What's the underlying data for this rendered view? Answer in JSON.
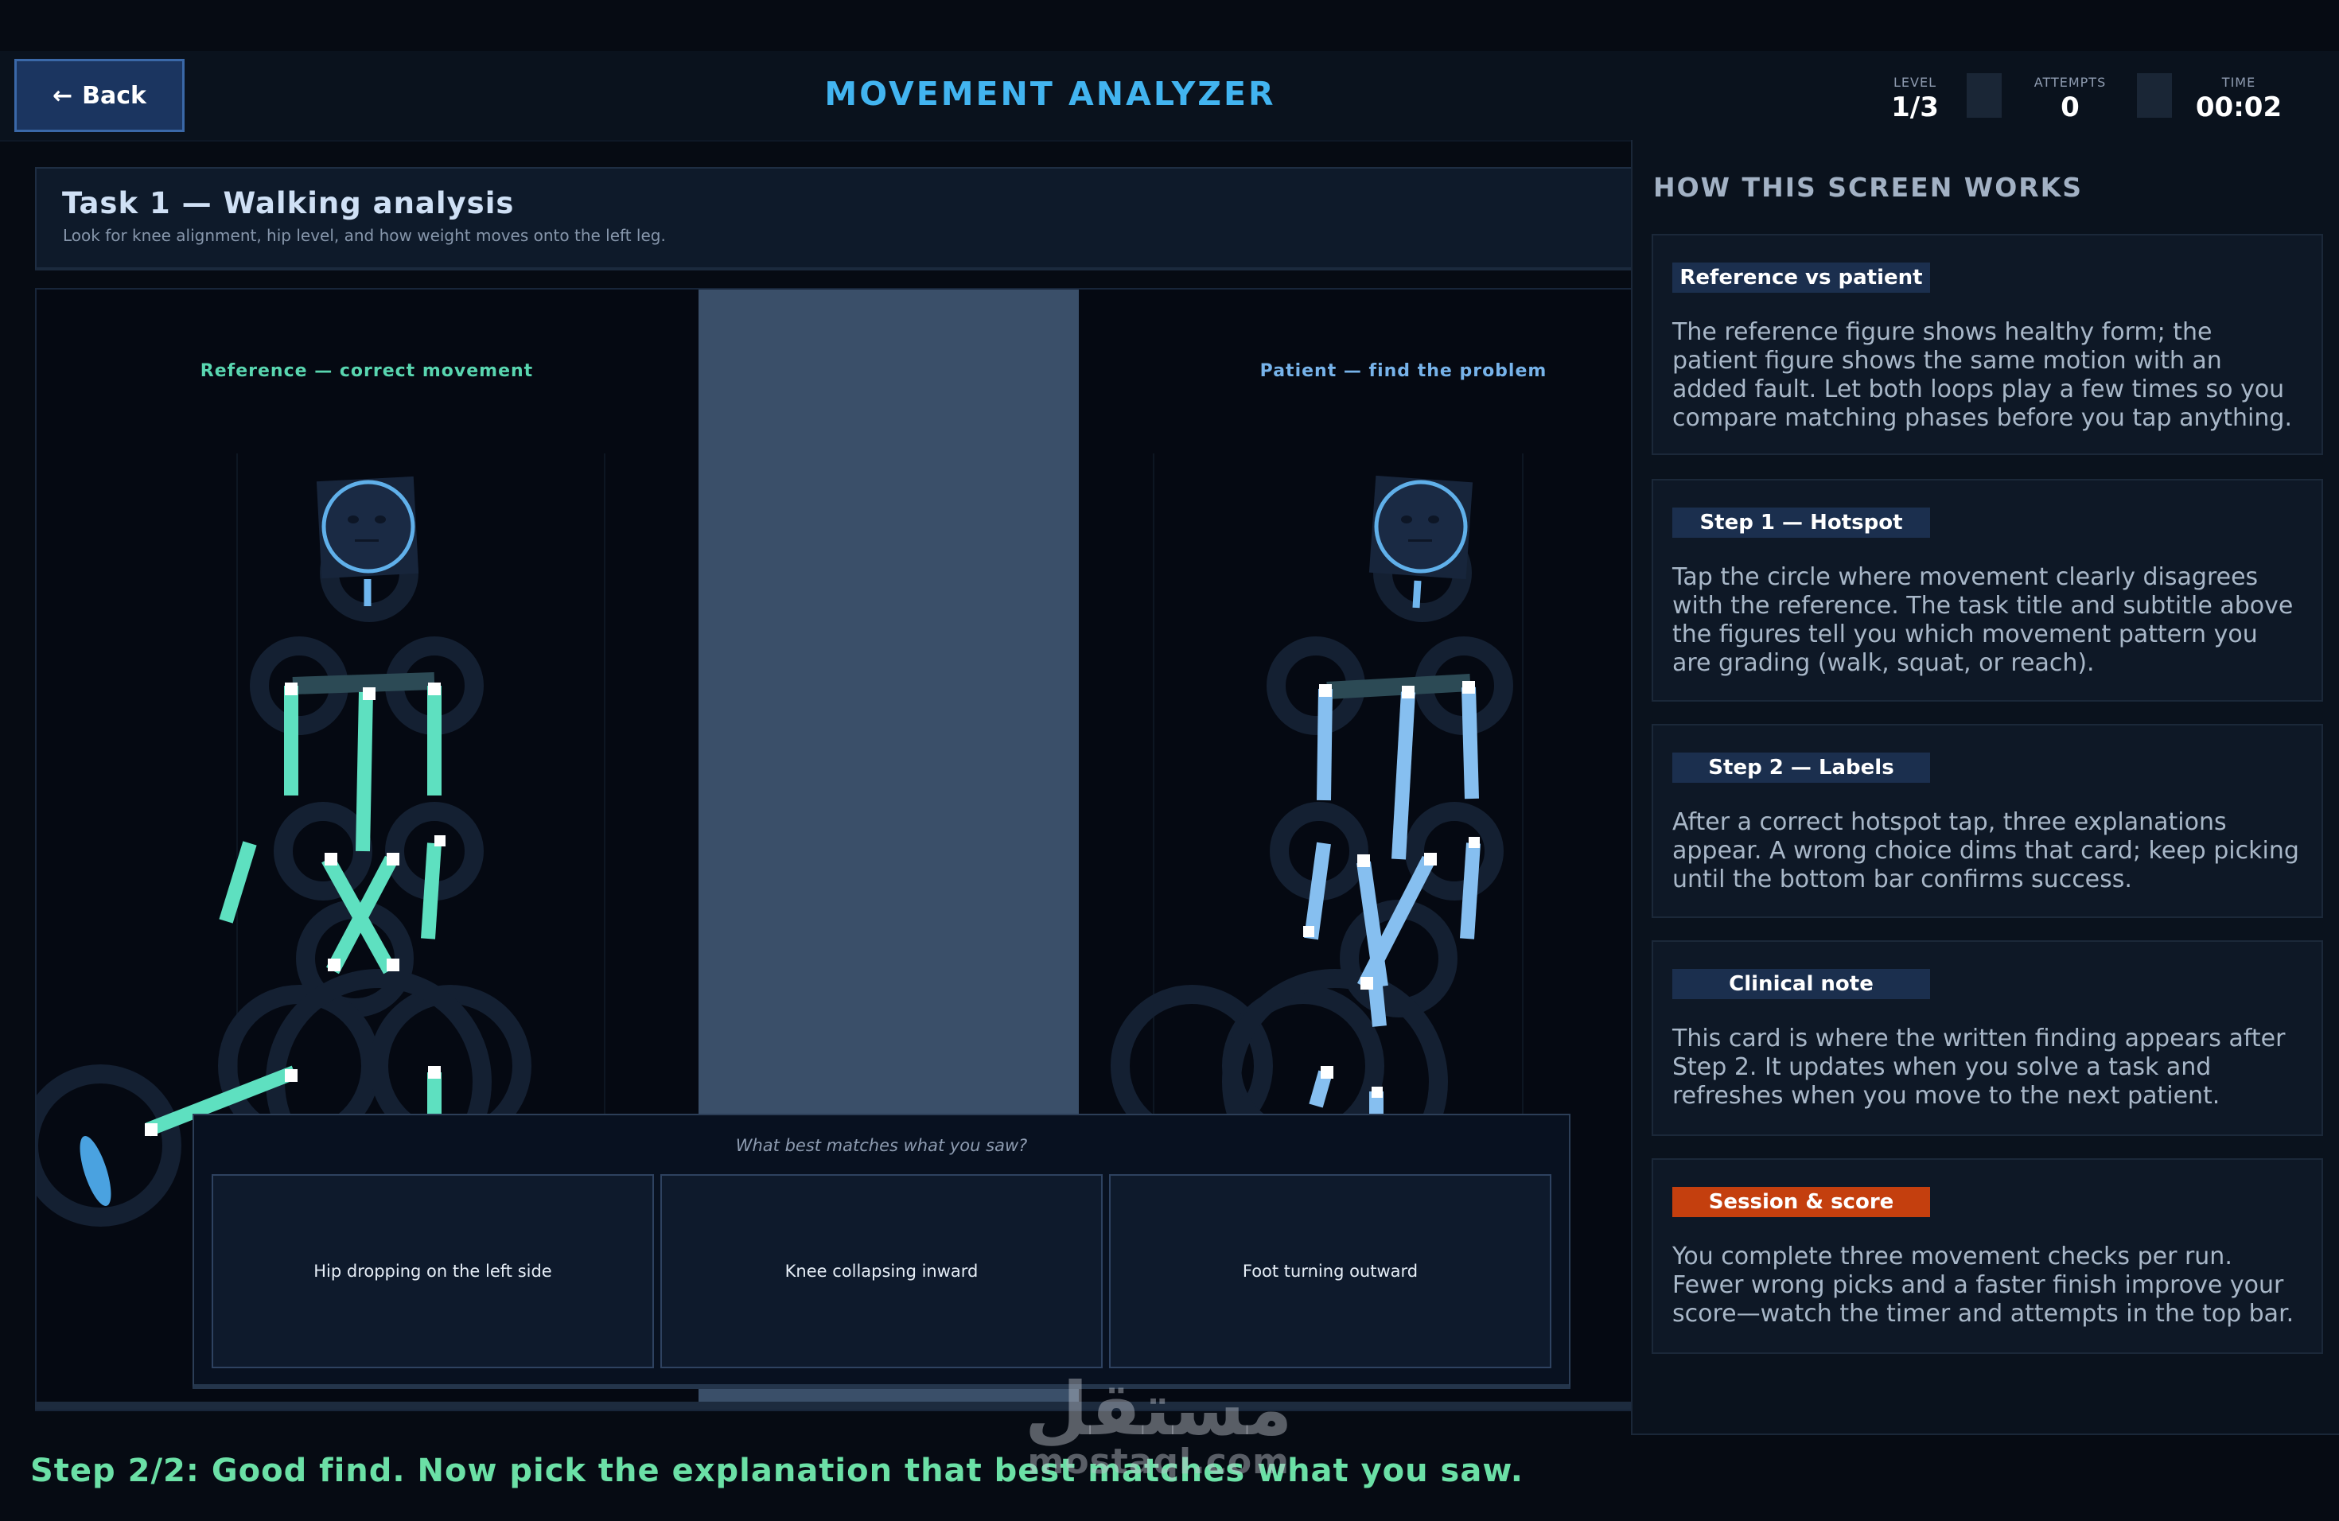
{
  "header": {
    "back_label": "Back",
    "back_arrow": "←",
    "title": "MOVEMENT ANALYZER",
    "stats": [
      {
        "label": "LEVEL",
        "value": "1/3"
      },
      {
        "label": "ATTEMPTS",
        "value": "0"
      },
      {
        "label": "TIME",
        "value": "00:02"
      }
    ]
  },
  "task": {
    "title": "Task 1 — Walking analysis",
    "subtitle": "Look for knee alignment, hip level, and how weight moves onto the left leg."
  },
  "panels": {
    "reference_label": "Reference — correct movement",
    "patient_label": "Patient — find the problem"
  },
  "colors": {
    "reference_limb": "#5ee0c0",
    "patient_limb": "#86bff0",
    "accent": "#42b4f0",
    "success": "#6be0a6",
    "tag_orange": "#c43f0e"
  },
  "choices": {
    "prompt": "What best matches what you saw?",
    "options": [
      "Hip dropping on the left side",
      "Knee collapsing inward",
      "Foot turning outward"
    ]
  },
  "status": "Step 2/2: Good find. Now pick the explanation that best matches what you saw.",
  "help": {
    "heading": "HOW THIS SCREEN WORKS",
    "cards": [
      {
        "tag": "Reference vs patient",
        "text": "The reference figure shows healthy form; the patient figure shows the same motion with an added fault. Let both loops play a few times so you compare matching phases before you tap anything."
      },
      {
        "tag": "Step 1 — Hotspot",
        "text": "Tap the circle where movement clearly disagrees with the reference. The task title and subtitle above the figures tell you which movement pattern you are grading (walk, squat, or reach)."
      },
      {
        "tag": "Step 2 — Labels",
        "text": "After a correct hotspot tap, three explanations appear. A wrong choice dims that card; keep picking until the bottom bar confirms success."
      },
      {
        "tag": "Clinical note",
        "text": "This card is where the written finding appears after Step 2. It updates when you solve a task and refreshes when you move to the next patient."
      },
      {
        "tag": "Session & score",
        "text": "You complete three movement checks per run. Fewer wrong picks and a faster finish improve your score—watch the timer and attempts in the top bar."
      }
    ]
  },
  "watermark": {
    "arabic": "مستقل",
    "latin": "mostaql.com"
  }
}
